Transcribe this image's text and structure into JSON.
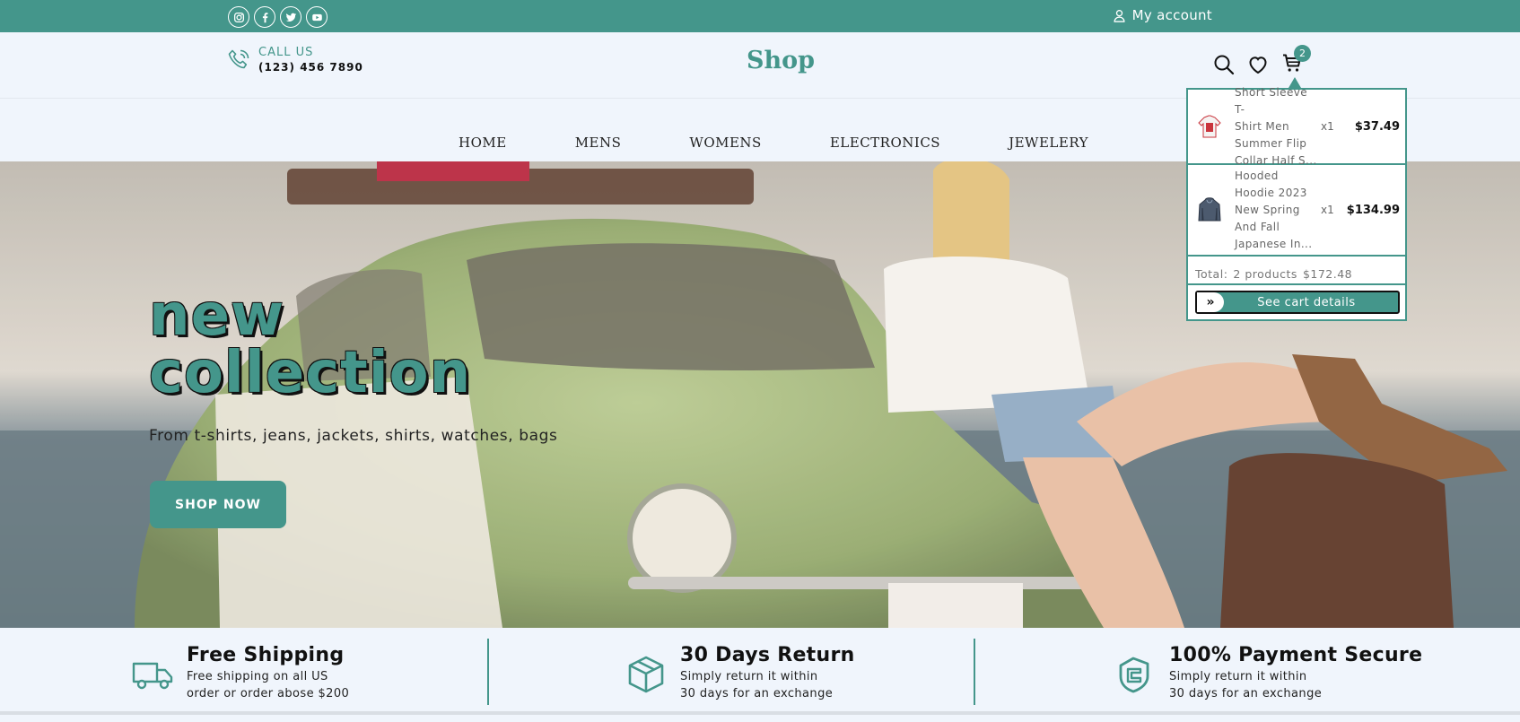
{
  "topbar": {
    "socials": [
      "instagram-icon",
      "facebook-icon",
      "twitter-icon",
      "youtube-icon"
    ],
    "account_label": "My account"
  },
  "header": {
    "call_label": "CALL US",
    "phone": "(123) 456 7890",
    "brand": "Shop",
    "cart_count": "2"
  },
  "nav": {
    "items": [
      "HOME",
      "MENS",
      "WOMENS",
      "ELECTRONICS",
      "JEWELERY"
    ]
  },
  "hero": {
    "title_line1": "new",
    "title_line2": "collection",
    "subtitle": "From t-shirts, jeans, jackets, shirts, watches, bags",
    "cta": "SHOP NOW"
  },
  "cart_popup": {
    "items": [
      {
        "name_lines": [
          "Short Sleeve T-",
          "Shirt Men",
          "Summer Flip",
          "Collar Half S..."
        ],
        "qty": "x1",
        "price": "$37.49"
      },
      {
        "name_lines": [
          "Hooded",
          "Hoodie 2023",
          "New Spring",
          "And Fall",
          "Japanese In..."
        ],
        "qty": "x1",
        "price": "$134.99"
      }
    ],
    "total_label": "Total:",
    "total_products": "2 products",
    "total_price": "$172.48",
    "details_label": "See cart details"
  },
  "features": [
    {
      "title": "Free Shipping",
      "desc_lines": [
        "Free shipping on all US",
        "order or order abose $200"
      ],
      "icon": "truck-icon"
    },
    {
      "title": "30 Days Return",
      "desc_lines": [
        "Simply return it within",
        "30 days for an exchange"
      ],
      "icon": "box-icon"
    },
    {
      "title": "100% Payment Secure",
      "desc_lines": [
        "Simply return it within",
        "30 days for an exchange"
      ],
      "icon": "shield-icon"
    }
  ],
  "colors": {
    "accent": "#44968b",
    "background": "#f0f5fc"
  }
}
